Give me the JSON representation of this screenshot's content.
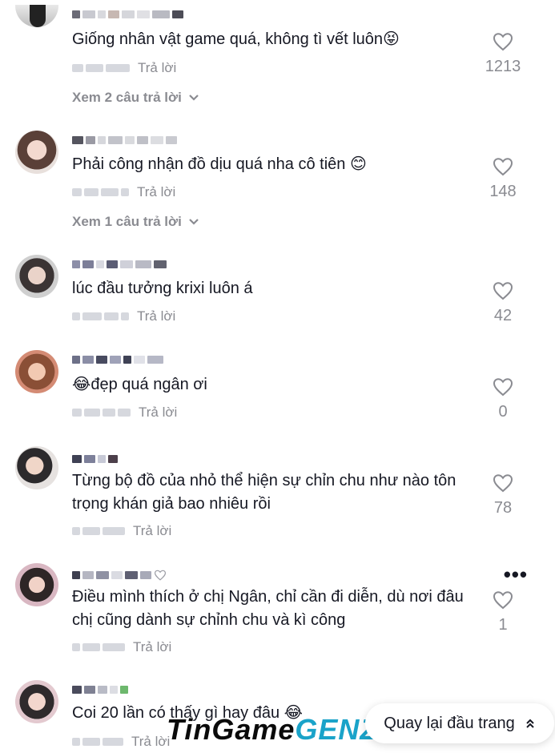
{
  "comments": [
    {
      "text": "Giống nhân vật game quá, không tì vết luôn😝",
      "reply_label": "Trả lời",
      "likes": "1213",
      "more_replies": "Xem 2 câu trả lời"
    },
    {
      "text": "Phải công nhận đồ dịu quá nha cô tiên 😊",
      "reply_label": "Trả lời",
      "likes": "148",
      "more_replies": "Xem 1 câu trả lời"
    },
    {
      "text": "lúc đầu tưởng krixi luôn á",
      "reply_label": "Trả lời",
      "likes": "42"
    },
    {
      "text": "😂đẹp quá ngân ơi",
      "reply_label": "Trả lời",
      "likes": "0"
    },
    {
      "text": "Từng bộ đồ của nhỏ thể hiện sự chỉn chu như nào tôn trọng khán giả bao nhiêu rồi",
      "reply_label": "Trả lời",
      "likes": "78"
    },
    {
      "text": "Điều mình thích ở chị Ngân, chỉ cần đi diễn, dù nơi đâu chị cũng dành sự chỉnh chu và kì công",
      "reply_label": "Trả lời",
      "likes": "1"
    },
    {
      "text": "Coi 20 lần có thấy gì hay đâu 😂",
      "reply_label": "Trả lời"
    }
  ],
  "back_to_top": "Quay lại đầu trang",
  "watermark": {
    "part1": "TinGame",
    "part2": "GENZ"
  },
  "colors": {
    "muted": "#8a8b91",
    "text": "#161823"
  },
  "icons": {
    "like": "heart-outline-icon",
    "expand": "chevron-down-icon",
    "back_top": "double-chevron-up-icon",
    "more": "more-dots-icon"
  }
}
